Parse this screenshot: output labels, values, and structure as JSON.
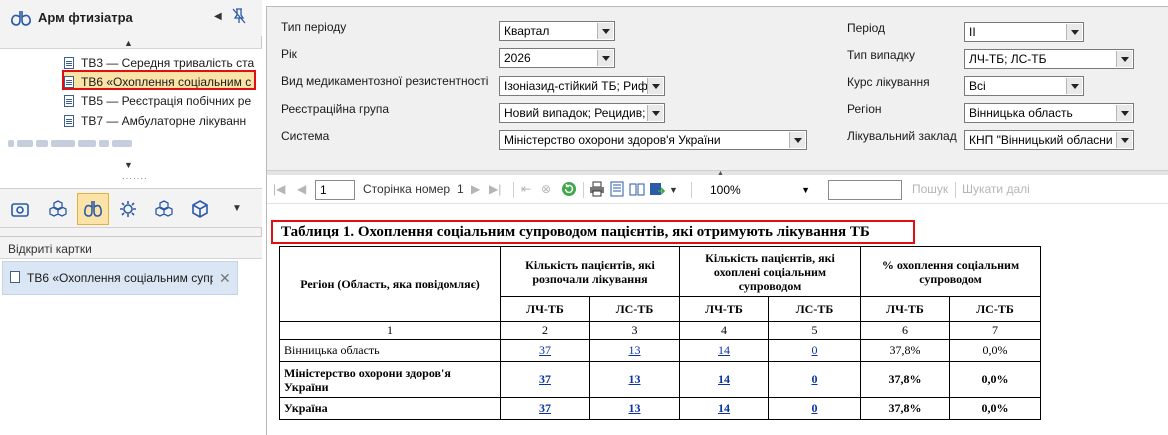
{
  "app": {
    "title": "Арм фтизіатра"
  },
  "tree": {
    "items": [
      {
        "label": "ТВ3 — Середня тривалість ста"
      },
      {
        "label": "ТВ6 «Охоплення соціальним с"
      },
      {
        "label": "ТВ5 — Реєстрація побічних ре"
      },
      {
        "label": "ТВ7 — Амбулаторне лікуванн"
      }
    ]
  },
  "open_cards": {
    "header": "Відкриті картки",
    "items": [
      {
        "label": "ТВ6 «Охоплення соціальним супр"
      }
    ]
  },
  "filters": {
    "period_type": {
      "label": "Тип періоду",
      "value": "Квартал"
    },
    "year": {
      "label": "Рік",
      "value": "2026"
    },
    "resistance": {
      "label": "Вид медикаментозної резистентності",
      "value": "Ізоніазид-стійкий ТБ; Рифа"
    },
    "reg_group": {
      "label": "Реєстраційна група",
      "value": "Новий випадок; Рецидив; Х"
    },
    "system": {
      "label": "Система",
      "value": "Міністерство охорони здоров'я України"
    },
    "period": {
      "label": "Період",
      "value": "II"
    },
    "case_type": {
      "label": "Тип випадку",
      "value": "ЛЧ-ТБ; ЛС-ТБ"
    },
    "treatment": {
      "label": "Курс лікування",
      "value": "Всі"
    },
    "region": {
      "label": "Регіон",
      "value": "Вінницька область"
    },
    "facility": {
      "label": "Лікувальний заклад",
      "value": "КНП \"Вінницький обласни"
    }
  },
  "toolbar": {
    "page_input": "1",
    "page_label": "Сторінка номер",
    "page_total": "1",
    "zoom": "100%",
    "search_value": "",
    "search_btn": "Пошук",
    "find_next": "Шукати далі"
  },
  "report": {
    "title": "Таблиця 1. Охоплення соціальним супроводом пацієнтів, які отримують лікування ТБ",
    "head": {
      "region_col": "Регіон (Область, яка повідомляє)",
      "group1": "Кількість пацієнтів, які розпочали лікування",
      "group2": "Кількість пацієнтів, які охоплені соціальним супроводом",
      "group3": "% охоплення соціальним супроводом",
      "lch": "ЛЧ-ТБ",
      "ls": "ЛС-ТБ",
      "n1": "1",
      "n2": "2",
      "n3": "3",
      "n4": "4",
      "n5": "5",
      "n6": "6",
      "n7": "7"
    },
    "rows": [
      {
        "region": "Вінницька область",
        "c2": "37",
        "c3": "13",
        "c4": "14",
        "c5": "0",
        "c6": "37,8%",
        "c7": "0,0%"
      },
      {
        "region": "Міністерство охорони здоров'я України",
        "c2": "37",
        "c3": "13",
        "c4": "14",
        "c5": "0",
        "c6": "37,8%",
        "c7": "0,0%"
      },
      {
        "region": "Україна",
        "c2": "37",
        "c3": "13",
        "c4": "14",
        "c5": "0",
        "c6": "37,8%",
        "c7": "0,0%"
      }
    ]
  },
  "colors": {
    "selection": "#fbe3a8",
    "highlight_border": "#e01010",
    "link": "#0a33a3",
    "card": "#dbe6f4"
  }
}
